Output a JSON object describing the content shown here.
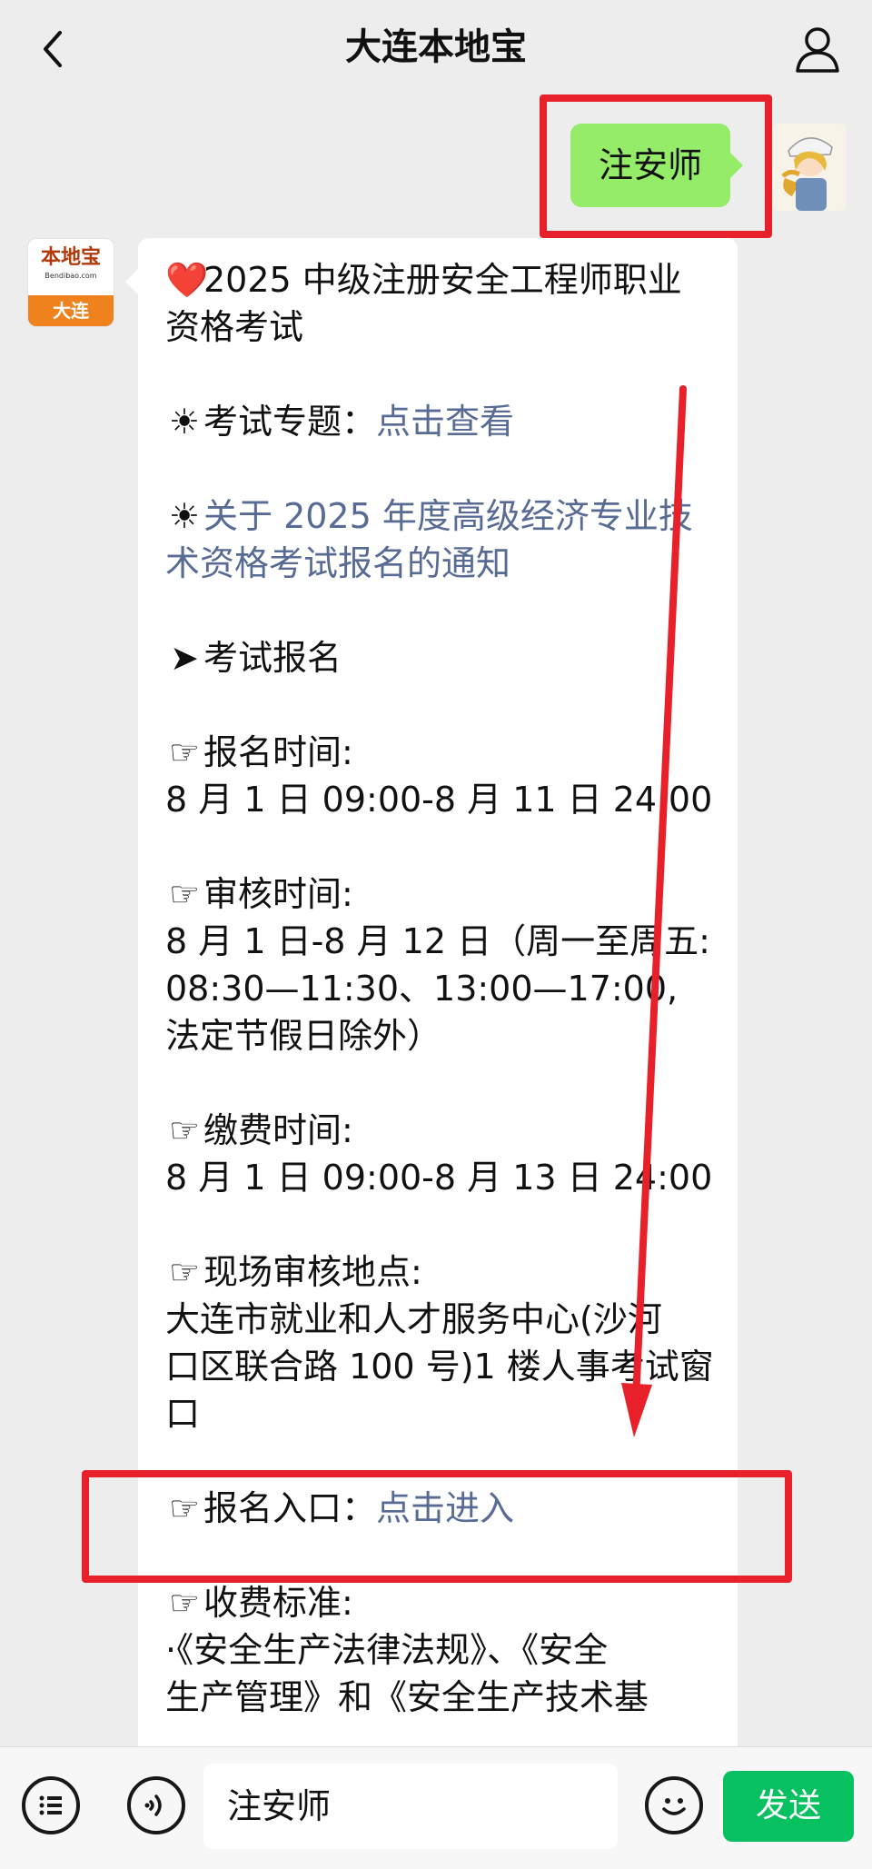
{
  "header": {
    "title": "大连本地宝"
  },
  "outgoing_message": "注安师",
  "bot_logo": {
    "name": "本地宝",
    "subtitle": "Bendibao.com",
    "city": "大连"
  },
  "message": {
    "title_l1": "2025 中级注册安全工程师职业",
    "title_l2": "资格考试",
    "topic_label": "考试专题：",
    "topic_link": "点击查看",
    "notice_l1": "关于 2025 年度高级经济专业技",
    "notice_l2": "术资格考试报名的通知",
    "section": "考试报名",
    "reg_time_label": "报名时间:",
    "reg_time_value": "8 月 1 日 09:00-8 月 11 日 24:00",
    "review_time_label": "审核时间:",
    "review_l1": "8 月 1 日-8 月 12 日（周一至周五:",
    "review_l2": "08:30—11:30、13:00—17:00,",
    "review_l3": "法定节假日除外）",
    "pay_time_label": "缴费时间:",
    "pay_time_value": "8 月 1 日 09:00-8 月 13 日 24:00",
    "site_label": "现场审核地点:",
    "site_l1": "大连市就业和人才服务中心(沙河",
    "site_l2": "口区联合路 100 号)1 楼人事考试窗",
    "site_l3": "口",
    "entry_label": "报名入口：",
    "entry_link": "点击进入",
    "fee_label": "收费标准:",
    "fee_l1": "·《安全生产法律法规》、《安全",
    "fee_l2": "生产管理》和《安全生产技术基"
  },
  "input_bar": {
    "text": "注安师",
    "send_label": "发送"
  },
  "colors": {
    "accent_red": "#e8202a",
    "bubble_green": "#95ec69",
    "send_green": "#07c160",
    "link_blue": "#576b95"
  }
}
